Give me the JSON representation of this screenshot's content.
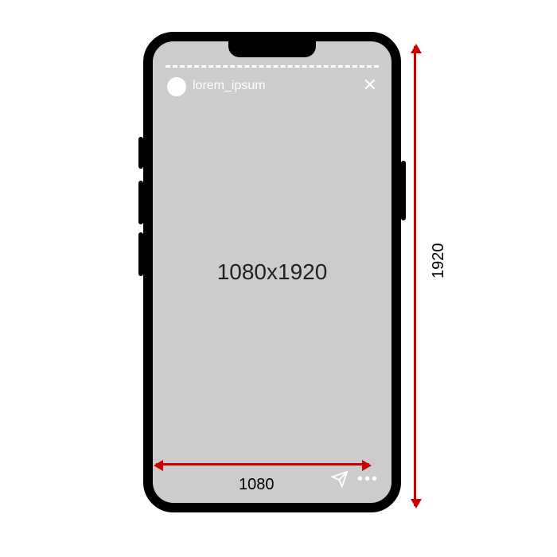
{
  "story": {
    "username": "lorem_ipsum",
    "center_label": "1080x1920"
  },
  "dimensions": {
    "width_label": "1080",
    "height_label": "1920"
  },
  "icons": {
    "close": "✕",
    "more": "•••"
  }
}
